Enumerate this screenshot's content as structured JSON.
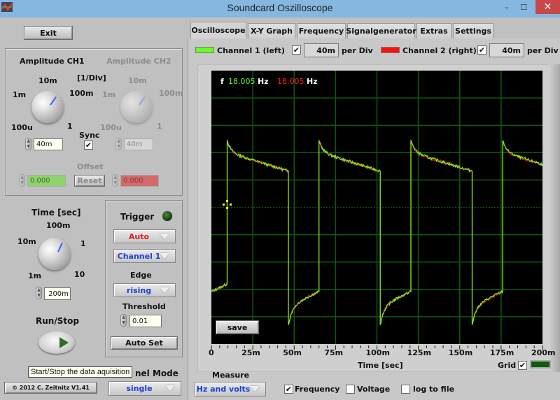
{
  "window": {
    "title": "Soundcard Oszilloscope",
    "controls": {
      "minimize": "–",
      "maximize": "☐",
      "close": "✕"
    }
  },
  "left": {
    "exit_label": "Exit",
    "amplitude": {
      "ch1_title": "Amplitude CH1",
      "ch2_title": "Amplitude CH2",
      "unit_label": "[1/Div]",
      "dial_ticks": [
        "100u",
        "1m",
        "10m",
        "100m",
        "1"
      ],
      "ch1_value": "40m",
      "ch2_value": "40m",
      "sync_label": "Sync",
      "sync_checked": true,
      "offset_label": "Offset",
      "offset_ch1": "0.000",
      "offset_ch2": "0.000",
      "reset_label": "Reset"
    },
    "time": {
      "title": "Time [sec]",
      "dial_ticks": [
        "1m",
        "10m",
        "100m",
        "1",
        "10"
      ],
      "value": "200m"
    },
    "trigger": {
      "title": "Trigger",
      "mode": "Auto",
      "channel": "Channel 1",
      "edge_label": "Edge",
      "edge": "rising",
      "threshold_label": "Threshold",
      "threshold": "0.01",
      "autoset_label": "Auto Set"
    },
    "run_stop_label": "Run/Stop",
    "tooltip": "Start/Stop the data aquisition",
    "channel_mode_label": "Channel Mode",
    "channel_mode_visible": "nel Mode",
    "channel_mode": "single",
    "copyright": "© 2012  C. Zeitnitz V1.41"
  },
  "tabs": [
    {
      "label": "Oscilloscope",
      "active": true
    },
    {
      "label": "X-Y Graph",
      "active": false
    },
    {
      "label": "Frequency",
      "active": false
    },
    {
      "label": "Signalgenerator",
      "active": false
    },
    {
      "label": "Extras",
      "active": false
    },
    {
      "label": "Settings",
      "active": false
    }
  ],
  "channels": {
    "ch1_label": "Channel 1 (left)",
    "ch1_color": "#66ff22",
    "ch1_enabled": true,
    "ch1_per_div": "40m",
    "ch2_label": "Channel 2 (right)",
    "ch2_color": "#ff1010",
    "ch2_enabled": true,
    "ch2_per_div": "40m",
    "per_div_label": "per Div"
  },
  "readout": {
    "f_label": "f",
    "ch1_freq": "18.005",
    "ch2_freq": "18.005",
    "unit": "Hz"
  },
  "plot": {
    "save_label": "save",
    "grid_label": "Grid",
    "grid_checked": true,
    "grid_color": "#0f5a0f"
  },
  "measure": {
    "title": "Measure",
    "mode": "Hz and volts",
    "frequency_label": "Frequency",
    "frequency_checked": true,
    "voltage_label": "Voltage",
    "voltage_checked": false,
    "log_label": "log to file",
    "log_checked": false
  },
  "chart_data": {
    "type": "line",
    "title": "",
    "xlabel": "Time [sec]",
    "ylabel": "",
    "xlim": [
      0,
      0.2
    ],
    "ylim": [
      -5,
      5
    ],
    "x_divisions": 8,
    "y_divisions": 10,
    "grid": true,
    "x_tick_labels": [
      "0",
      "25m",
      "50m",
      "75m",
      "100m",
      "125m",
      "150m",
      "175m",
      "200m"
    ],
    "trigger_marker": {
      "t": 0.0095,
      "level": 0.0
    },
    "waveform": {
      "shape": "square wave with RC overshoot/decay",
      "frequency_hz": 18.005,
      "period_s": 0.0555,
      "rising_edges_s": [
        0.0095,
        0.065,
        0.1205,
        0.176
      ],
      "falling_edges_s": [
        0.0465,
        0.102,
        0.1575
      ],
      "high_peak_div": 2.45,
      "high_end_div": 1.5,
      "low_peak_div": -4.3,
      "low_end_div": -2.8,
      "pre_edge_low_div": -2.9
    },
    "series": [
      {
        "name": "Channel 1 (left)",
        "color": "#66ff22"
      },
      {
        "name": "Channel 2 (right)",
        "color": "#ff1010"
      }
    ]
  }
}
